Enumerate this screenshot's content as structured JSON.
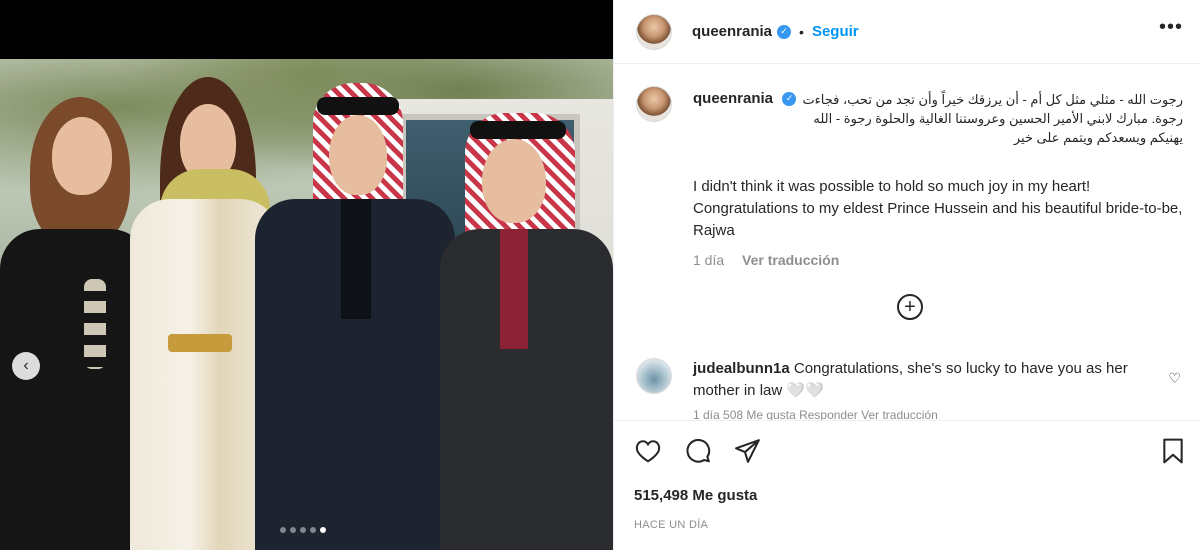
{
  "post": {
    "username": "queenrania",
    "follow_label": "Seguir",
    "separator": "•",
    "verified_icon": "verified-badge-icon"
  },
  "caption": {
    "username": "queenrania",
    "arabic_text": "رجوت الله - مثلي مثل كل أم - أن يرزقك خيراً وأن تجد من تحب، فجاءت رجوة. مبارك لابني الأمير الحسين وعروستنا الغالية والحلوة رجوة - الله يهنيكم ويسعدكم ويتمم على خير",
    "english_text": "I didn't think it was possible to hold so much joy in my heart! Congratulations to my eldest Prince Hussein and his beautiful bride-to-be, Rajwa",
    "time": "1 día",
    "translate": "Ver traducción"
  },
  "comment": {
    "username": "judealbunn1a",
    "text": " Congratulations, she's so lucky to have you as her mother in law 🤍🤍",
    "meta": "1 día   508 Me gusta   Responder   Ver traducción"
  },
  "stats": {
    "likes": "515,498 Me gusta",
    "date": "HACE UN DÍA"
  },
  "carousel": {
    "count": 5,
    "active_index": 4
  },
  "colors": {
    "accent": "#0095f6",
    "verified": "#3897f0",
    "muted": "#8e8e8e"
  }
}
